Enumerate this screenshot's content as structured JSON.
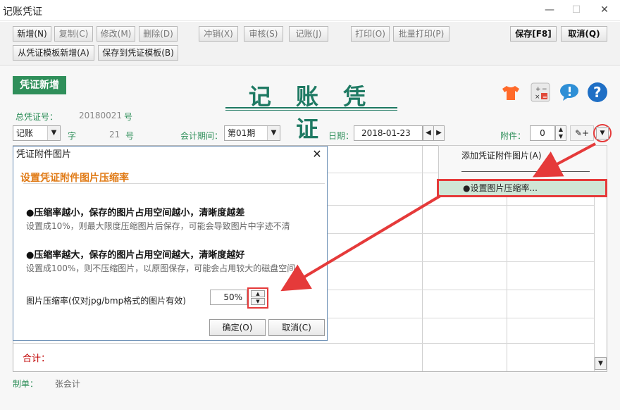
{
  "window": {
    "title": "记账凭证",
    "min": "—",
    "max": "☐",
    "close": "✕"
  },
  "toolbar": {
    "row1": [
      "新增(N)",
      "复制(C)",
      "修改(M)",
      "删除(D)",
      "冲销(X)",
      "审核(S)",
      "记账(J)",
      "打印(O)",
      "批量打印(P)"
    ],
    "save": "保存[F8]",
    "cancel": "取消(Q)",
    "row2": [
      "从凭证模板新增(A)",
      "保存到凭证模板(B)"
    ]
  },
  "header": {
    "badge": "凭证新增",
    "big_title": "记 账 凭 证",
    "total_no_label": "总凭证号：",
    "total_no_value": "20180021",
    "hao": "号",
    "voucher_type": "记账",
    "zi": "字",
    "voucher_num": "21",
    "period_label": "会计期间：",
    "period_value": "第01期",
    "date_label": "日期：",
    "date_value": "2018-01-23",
    "attach_label": "附件：",
    "attach_value": "0"
  },
  "icons": [
    "shirt-icon",
    "calculator-icon",
    "chat-icon",
    "help-icon"
  ],
  "menu": {
    "add": "添加凭证附件图片(A)",
    "set": "●设置图片压缩率..."
  },
  "dialog": {
    "title": "凭证附件图片",
    "close": "✕",
    "heading": "设置凭证附件图片压缩率",
    "b1_title": "●压缩率越小，保存的图片占用空间越小，清晰度越差",
    "b1_text": "设置成10%，则最大限度压缩图片后保存，可能会导致图片中字迹不清",
    "b2_title": "●压缩率越大，保存的图片占用空间越大，清晰度越好",
    "b2_text": "设置成100%，则不压缩图片，以原图保存，可能会占用较大的磁盘空间",
    "rate_label": "图片压缩率(仅对jpg/bmp格式的图片有效)",
    "rate_value": "50%",
    "ok": "确定(O)",
    "cancel": "取消(C)"
  },
  "grid": {
    "total_label": "合计："
  },
  "footer": {
    "maker_label": "制单：",
    "maker_value": "张会计"
  },
  "colors": {
    "accent": "#2f8f5a",
    "title": "#1f7a63",
    "highlight": "#e53a3a",
    "heading": "#e07a15"
  }
}
